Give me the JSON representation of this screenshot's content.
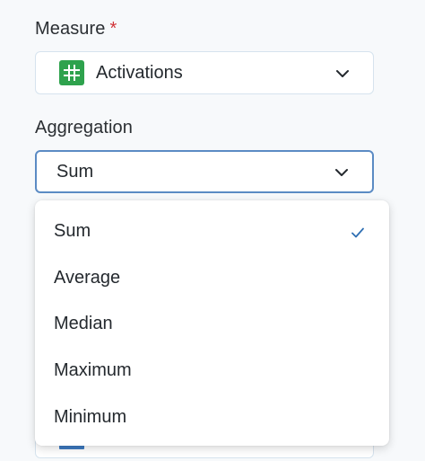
{
  "measure": {
    "label": "Measure",
    "required_marker": "*",
    "value": "Activations",
    "icon": "grid-hash-icon",
    "icon_color": "#2ea24d"
  },
  "aggregation": {
    "label": "Aggregation",
    "value": "Sum",
    "accent_color": "#5b8bc4",
    "options": [
      {
        "label": "Sum",
        "selected": true
      },
      {
        "label": "Average",
        "selected": false
      },
      {
        "label": "Median",
        "selected": false
      },
      {
        "label": "Maximum",
        "selected": false
      },
      {
        "label": "Minimum",
        "selected": false
      }
    ]
  },
  "colors": {
    "required": "#d13438",
    "check": "#2f6fb3"
  }
}
